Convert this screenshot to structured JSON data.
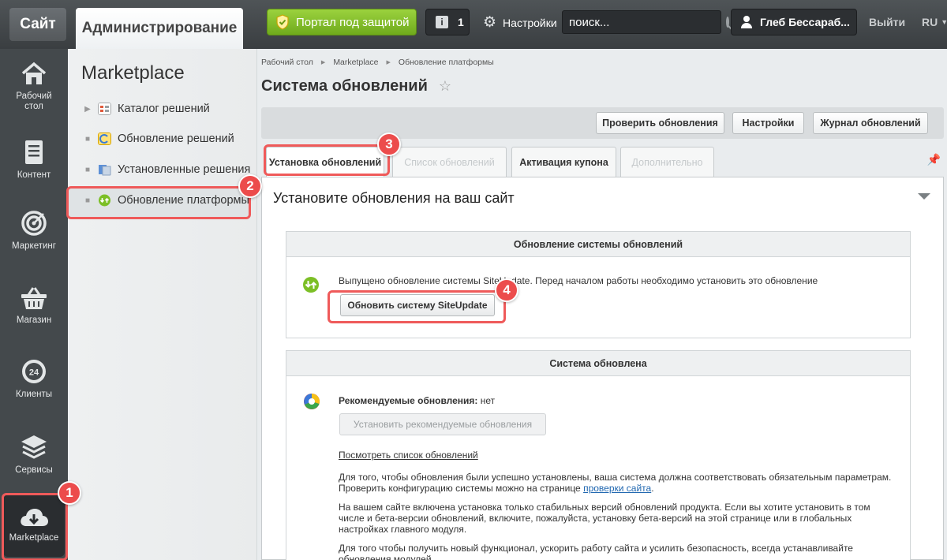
{
  "topbar": {
    "site_tab": "Сайт",
    "admin_tab": "Администрирование",
    "protect_button": "Портал под защитой",
    "notifications_count": "1",
    "settings_label": "Настройки",
    "search_placeholder": "поиск...",
    "user_name": "Глеб Бессараб...",
    "logout": "Выйти",
    "language": "RU"
  },
  "iconbar": {
    "items": [
      {
        "label": "Рабочий стол",
        "icon": "home-icon"
      },
      {
        "label": "Контент",
        "icon": "document-icon"
      },
      {
        "label": "Маркетинг",
        "icon": "target-icon"
      },
      {
        "label": "Магазин",
        "icon": "basket-icon"
      },
      {
        "label": "Клиенты",
        "icon": "clients-24-icon",
        "badge": "24"
      },
      {
        "label": "Сервисы",
        "icon": "layers-icon"
      },
      {
        "label": "Marketplace",
        "icon": "cloud-download-icon"
      }
    ]
  },
  "submenu": {
    "title": "Marketplace",
    "items": [
      {
        "label": "Каталог решений"
      },
      {
        "label": "Обновление решений"
      },
      {
        "label": "Установленные решения"
      },
      {
        "label": "Обновление платформы"
      }
    ]
  },
  "breadcrumb": [
    "Рабочий стол",
    "Marketplace",
    "Обновление платформы"
  ],
  "page_title": "Система обновлений",
  "toolbar": {
    "check_updates": "Проверить обновления",
    "settings": "Настройки",
    "log": "Журнал обновлений"
  },
  "tabs": [
    {
      "label": "Установка обновлений",
      "state": "active"
    },
    {
      "label": "Список обновлений",
      "state": "disabled"
    },
    {
      "label": "Активация купона",
      "state": "normal"
    },
    {
      "label": "Дополнительно",
      "state": "disabled"
    }
  ],
  "content": {
    "title": "Установите обновления на ваш сайт",
    "panel1": {
      "header": "Обновление системы обновлений",
      "message": "Выпущено обновление системы SiteUpdate. Перед началом работы необходимо установить это обновление",
      "button": "Обновить систему SiteUpdate"
    },
    "panel2": {
      "header": "Система обновлена",
      "recommended_label": "Рекомендуемые обновления:",
      "recommended_value": "нет",
      "install_button": "Установить рекомендуемые обновления",
      "view_list_link": "Посмотреть список обновлений",
      "para1_line1": "Для того, чтобы обновления были успешно установлены, ваша система должна соответствовать обязательным параметрам.",
      "para1_line2": "Проверить конфигурацию системы можно на странице",
      "para1_link": "проверки сайта",
      "para2": "На вашем сайте включена установка только стабильных версий обновлений продукта. Если вы хотите установить в том числе и бета-версии обновлений, включите, пожалуйста, установку бета-версий на этой странице или в глобальных настройках главного модуля.",
      "para3_line1": "Для того чтобы получить новый функционал, ускорить работу сайта и усилить безопасность, всегда устанавливайте",
      "para3_line2": "обновления модулей."
    }
  },
  "annotations": [
    "1",
    "2",
    "3",
    "4"
  ],
  "colors": {
    "accent_green": "#7cbf26",
    "callout_red": "#ec4c4c",
    "link_blue": "#2067b0"
  }
}
